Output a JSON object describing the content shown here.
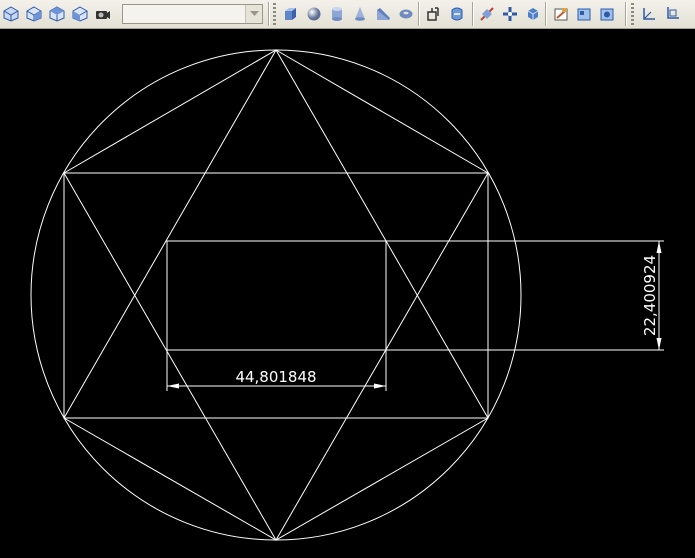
{
  "toolbar": {
    "view_select": {
      "value": ""
    },
    "groups": [
      {
        "name": "views",
        "icons": [
          "sw-iso-view-icon",
          "se-iso-view-icon",
          "ne-iso-view-icon",
          "nw-iso-view-icon"
        ]
      },
      {
        "name": "camera",
        "icons": [
          "camera-icon"
        ]
      },
      {
        "name": "solids",
        "icons": [
          "box-solid-icon",
          "sphere-solid-icon",
          "cylinder-solid-icon",
          "cone-solid-icon",
          "wedge-solid-icon",
          "torus-solid-icon"
        ]
      },
      {
        "name": "modeling",
        "icons": [
          "extrude-icon",
          "revolve-icon"
        ]
      },
      {
        "name": "section",
        "icons": [
          "slice-icon",
          "section-icon",
          "interfere-icon"
        ]
      },
      {
        "name": "setup",
        "icons": [
          "setup-drawing-icon",
          "setup-view-icon",
          "setup-profile-icon"
        ]
      },
      {
        "name": "ucs",
        "icons": [
          "ucs-icon",
          "ucs-origin-icon"
        ]
      }
    ]
  },
  "drawing": {
    "background": "#000000",
    "line_color": "#ffffff",
    "dimensions": {
      "horizontal": {
        "text": "44,801848"
      },
      "vertical": {
        "text": "22,400924"
      }
    }
  }
}
